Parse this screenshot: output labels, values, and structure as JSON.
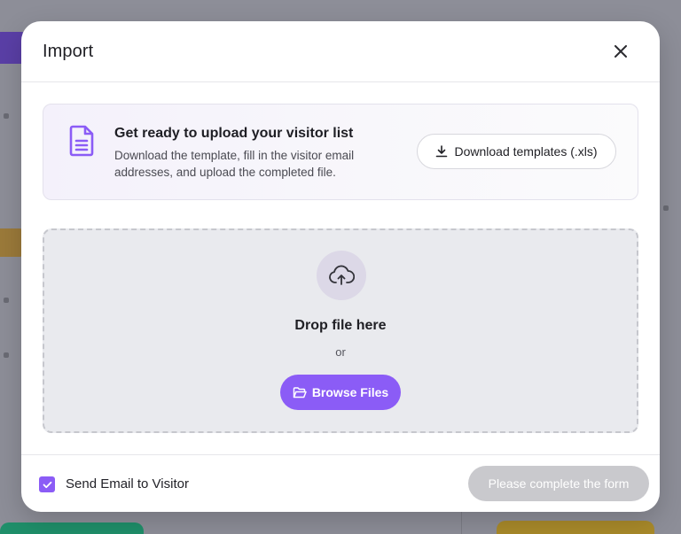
{
  "modal": {
    "title": "Import",
    "info": {
      "title": "Get ready to upload your visitor list",
      "description": "Download the template, fill in the visitor email addresses, and upload the completed file.",
      "download_label": "Download templates (.xls)"
    },
    "dropzone": {
      "title": "Drop file here",
      "or": "or",
      "browse_label": "Browse Files"
    },
    "footer": {
      "checkbox_label": "Send Email to Visitor",
      "checkbox_checked": true,
      "submit_label": "Please complete the form"
    }
  },
  "colors": {
    "accent": "#8b5cf6",
    "disabled": "#c9c9cd",
    "dropzone_bg": "#e9eaee"
  },
  "icons": {
    "close": "close-icon",
    "document": "document-icon",
    "download": "download-icon",
    "upload": "cloud-upload-icon",
    "folder": "folder-open-icon",
    "check": "check-icon"
  }
}
